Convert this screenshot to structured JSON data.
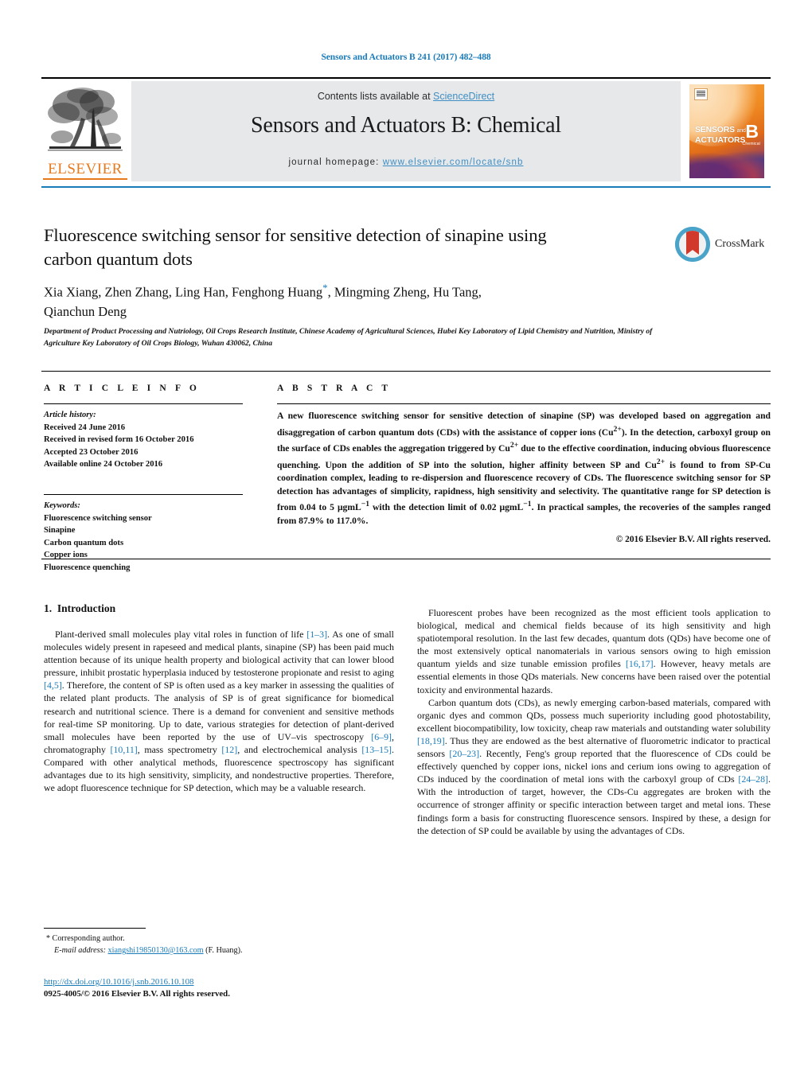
{
  "running_head": "Sensors and Actuators B 241 (2017) 482–488",
  "masthead": {
    "contents_prefix": "Contents lists available at ",
    "sciencedirect": "ScienceDirect",
    "journal_title": "Sensors and Actuators B: Chemical",
    "homepage_label": "journal homepage:",
    "homepage_url": "www.elsevier.com/locate/snb",
    "publisher_logo_text": "ELSEVIER",
    "cover": {
      "line1": "SENSORS",
      "and": "and",
      "line2": "ACTUATORS",
      "volume_letter": "B",
      "volume_sub": "Chemical"
    },
    "accent_color": "#3f8fc4",
    "brand_color": "#e87a1e"
  },
  "article": {
    "title": "Fluorescence switching sensor for sensitive detection of sinapine using carbon quantum dots",
    "authors_line1": "Xia Xiang, Zhen Zhang, Ling Han, Fenghong Huang",
    "authors_star": "*",
    "authors_line1_rest": ", Mingming Zheng, Hu Tang,",
    "authors_line2": "Qianchun Deng",
    "affiliation": "Department of Product Processing and Nutriology, Oil Crops Research Institute, Chinese Academy of Agricultural Sciences, Hubei Key Laboratory of Lipid Chemistry and Nutrition, Ministry of Agriculture Key Laboratory of Oil Crops Biology, Wuhan 430062, China",
    "crossmark_label": "CrossMark"
  },
  "article_info": {
    "heading": "A R T I C L E    I N F O",
    "history_label": "Article history:",
    "history": [
      "Received 24 June 2016",
      "Received in revised form 16 October 2016",
      "Accepted 23 October 2016",
      "Available online 24 October 2016"
    ],
    "keywords_label": "Keywords:",
    "keywords": [
      "Fluorescence switching sensor",
      "Sinapine",
      "Carbon quantum dots",
      "Copper ions",
      "Fluorescence quenching"
    ]
  },
  "abstract": {
    "heading": "A B S T R A C T",
    "text": "A new fluorescence switching sensor for sensitive detection of sinapine (SP) was developed based on aggregation and disaggregation of carbon quantum dots (CDs) with the assistance of copper ions (Cu2+). In the detection, carboxyl group on the surface of CDs enables the aggregation triggered by Cu2+ due to the effective coordination, inducing obvious fluorescence quenching. Upon the addition of SP into the solution, higher affinity between SP and Cu2+ is found to from SP-Cu coordination complex, leading to re-dispersion and fluorescence recovery of CDs. The fluorescence switching sensor for SP detection has advantages of simplicity, rapidness, high sensitivity and selectivity. The quantitative range for SP detection is from 0.04 to 5 μgmL−1 with the detection limit of 0.02 μgmL−1. In practical samples, the recoveries of the samples ranged from 87.9% to 117.0%.",
    "copyright": "© 2016 Elsevier B.V. All rights reserved."
  },
  "body": {
    "section_number": "1.",
    "section_title": "Introduction",
    "left_paragraphs": [
      "Plant-derived small molecules play vital roles in function of life [1–3]. As one of small molecules widely present in rapeseed and medical plants, sinapine (SP) has been paid much attention because of its unique health property and biological activity that can lower blood pressure, inhibit prostatic hyperplasia induced by testosterone propionate and resist to aging [4,5]. Therefore, the content of SP is often used as a key marker in assessing the qualities of the related plant products. The analysis of SP is of great significance for biomedical research and nutritional science. There is a demand for convenient and sensitive methods for real-time SP monitoring. Up to date, various strategies for detection of plant-derived small molecules have been reported by the use of UV–vis spectroscopy [6–9], chromatography [10,11], mass spectrometry [12], and electrochemical analysis [13–15]. Compared with other analytical methods, fluorescence spectroscopy has significant advantages due to its high sensitivity, simplicity, and nondestructive properties. Therefore, we adopt fluorescence technique for SP detection, which may be a valuable research."
    ],
    "right_paragraphs": [
      "Fluorescent probes have been recognized as the most efficient tools application to biological, medical and chemical fields because of its high sensitivity and high spatiotemporal resolution. In the last few decades, quantum dots (QDs) have become one of the most extensively optical nanomaterials in various sensors owing to high emission quantum yields and size tunable emission profiles [16,17]. However, heavy metals are essential elements in those QDs materials. New concerns have been raised over the potential toxicity and environmental hazards.",
      "Carbon quantum dots (CDs), as newly emerging carbon-based materials, compared with organic dyes and common QDs, possess much superiority including good photostability, excellent biocompatibility, low toxicity, cheap raw materials and outstanding water solubility [18,19]. Thus they are endowed as the best alternative of fluorometric indicator to practical sensors [20–23]. Recently, Feng's group reported that the fluorescence of CDs could be effectively quenched by copper ions, nickel ions and cerium ions owing to aggregation of CDs induced by the coordination of metal ions with the carboxyl group of CDs [24–28]. With the introduction of target, however, the CDs-Cu aggregates are broken with the occurrence of stronger affinity or specific interaction between target and metal ions. These findings form a basis for constructing fluorescence sensors. Inspired by these, a design for the detection of SP could be available by using the advantages of CDs."
    ]
  },
  "footer": {
    "corresponding_marker": "*",
    "corresponding_label": "Corresponding author.",
    "email_label": "E-mail address:",
    "email": "xiangshi19850130@163.com",
    "email_owner": "(F. Huang).",
    "doi": "http://dx.doi.org/10.1016/j.snb.2016.10.108",
    "issn_line": "0925-4005/© 2016 Elsevier B.V. All rights reserved."
  }
}
